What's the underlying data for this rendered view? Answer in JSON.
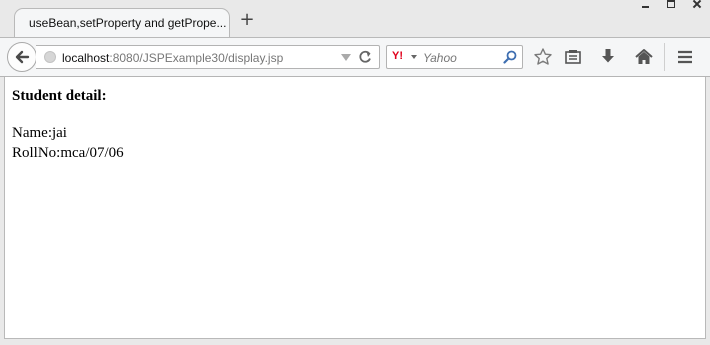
{
  "browser": {
    "tab": {
      "title": "useBean,setProperty and getPrope..."
    },
    "new_tab_symbol": "+",
    "url": {
      "host": "localhost",
      "rest": ":8080/JSPExample30/display.jsp"
    },
    "search": {
      "engine_logo": "Y!",
      "placeholder": "Yahoo"
    },
    "icons": [
      "back-arrow-icon",
      "globe-icon",
      "dropdown-icon",
      "reload-icon",
      "search-icon",
      "bookmark-star-icon",
      "reading-list-icon",
      "download-icon",
      "home-icon",
      "menu-icon"
    ]
  },
  "page": {
    "heading": "Student detail:",
    "lines": [
      "Name:jai",
      "RollNo:mca/07/06"
    ]
  }
}
